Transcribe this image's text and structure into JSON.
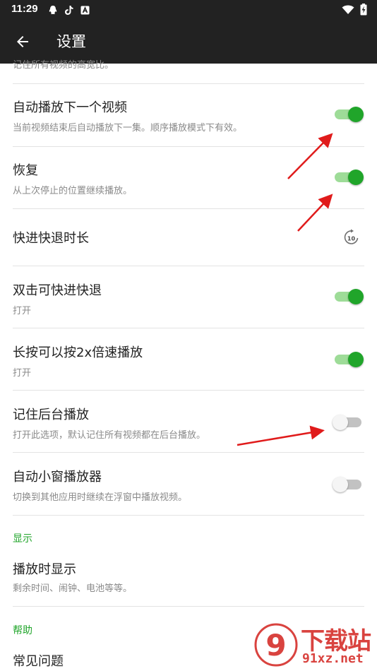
{
  "status_bar": {
    "time": "11:29",
    "icons": [
      "qq-icon",
      "tiktok-icon",
      "a-box-icon"
    ],
    "right_icons": [
      "wifi-icon",
      "battery-charging-icon"
    ]
  },
  "app_bar": {
    "back_icon": "arrow-back-icon",
    "title": "设置"
  },
  "settings": {
    "partial_top_text": "记住所有视频的高宽比。",
    "items": [
      {
        "title": "自动播放下一个视频",
        "subtitle": "当前视频结束后自动播放下一集。顺序播放模式下有效。",
        "control": "switch",
        "checked": true
      },
      {
        "title": "恢复",
        "subtitle": "从上次停止的位置继续播放。",
        "control": "switch",
        "checked": true
      },
      {
        "title": "快进快退时长",
        "subtitle": "",
        "control": "icon",
        "icon": "replay-10-icon",
        "icon_text": "10"
      },
      {
        "title": "双击可快进快退",
        "subtitle": "打开",
        "control": "switch",
        "checked": true
      },
      {
        "title": "长按可以按2x倍速播放",
        "subtitle": "打开",
        "control": "switch",
        "checked": true
      },
      {
        "title": "记住后台播放",
        "subtitle": "打开此选项，默认记住所有视频都在后台播放。",
        "control": "switch",
        "checked": false
      },
      {
        "title": "自动小窗播放器",
        "subtitle": "切换到其他应用时继续在浮窗中播放视频。",
        "control": "switch",
        "checked": false
      }
    ],
    "display_section": {
      "header": "显示",
      "items": [
        {
          "title": "播放时显示",
          "subtitle": "剩余时间、闹钟、电池等等。"
        }
      ]
    },
    "help_section": {
      "header": "帮助",
      "items": [
        {
          "title": "常见问题"
        }
      ]
    }
  },
  "watermark": {
    "big_text": "下载站",
    "small_text": "91xz.net",
    "logo_icon": "9-logo-icon"
  },
  "colors": {
    "bar_bg": "#222222",
    "accent_green": "#20a52a",
    "switch_track_on": "#9edc98",
    "annotation_red": "#e01b1b",
    "watermark_red": "#d9433f"
  }
}
